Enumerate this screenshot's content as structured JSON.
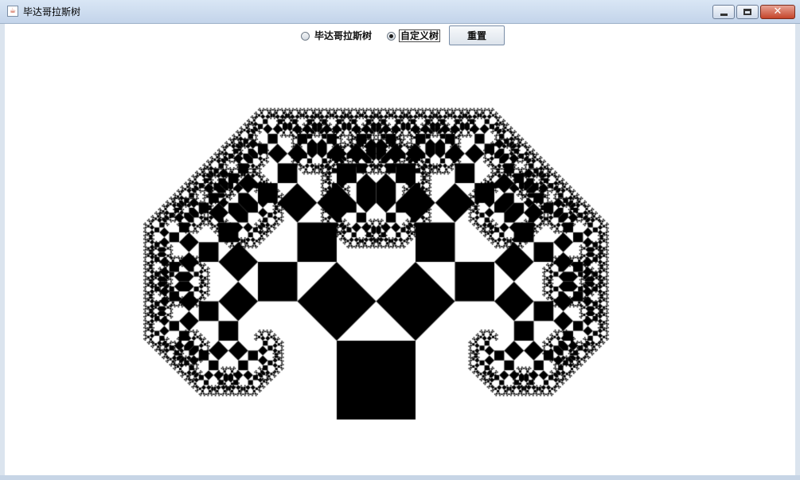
{
  "window": {
    "title": "毕达哥拉斯树",
    "icon": "java-cup-icon"
  },
  "controls": {
    "radio_pythagoras": {
      "label": "毕达哥拉斯树",
      "selected": false
    },
    "radio_custom": {
      "label": "自定义树",
      "selected": true
    },
    "reset_label": "重置"
  },
  "canvas": {
    "fill_color": "#000000",
    "background_color": "#ffffff",
    "recursion_depth": 12
  }
}
